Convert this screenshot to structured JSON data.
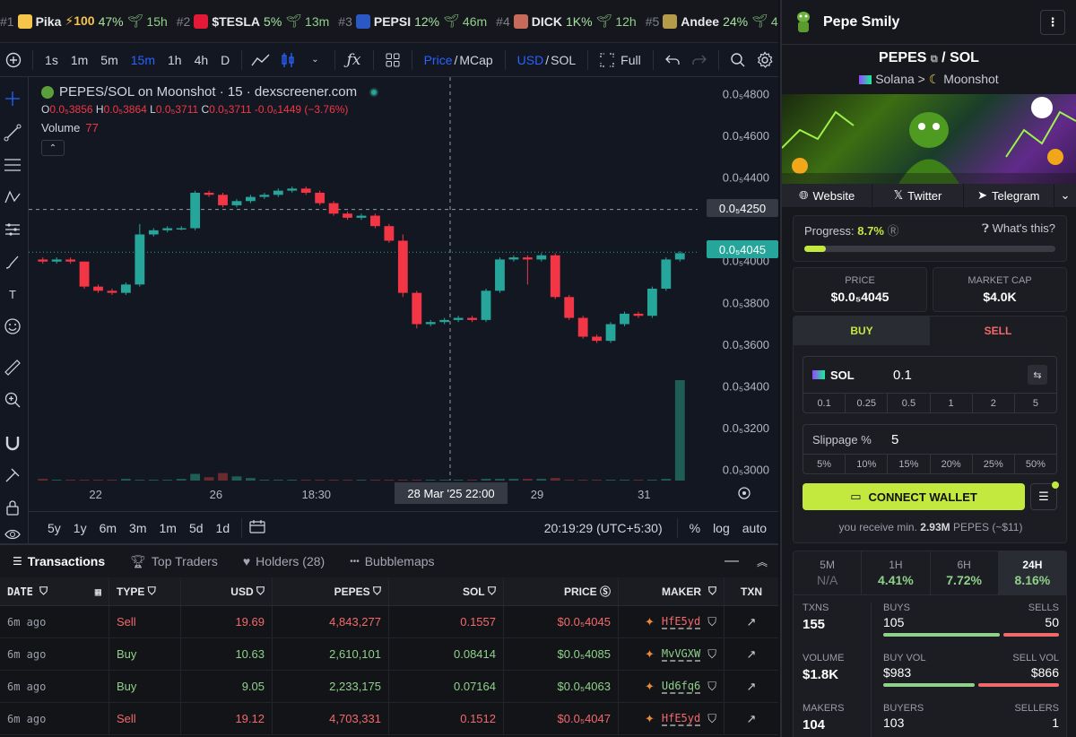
{
  "trending": [
    {
      "rank": "#1",
      "name": "Pika",
      "boost": "⚡100",
      "change": "47%",
      "age": "15h",
      "icon_color": "#f5c44b"
    },
    {
      "rank": "#2",
      "name": "$TESLA",
      "boost": "",
      "change": "5%",
      "age": "13m",
      "icon_color": "#e31937"
    },
    {
      "rank": "#3",
      "name": "PEPSI",
      "boost": "",
      "change": "12%",
      "age": "46m",
      "icon_color": "#2a59c6"
    },
    {
      "rank": "#4",
      "name": "DICK",
      "boost": "",
      "change": "1K%",
      "age": "12h",
      "icon_color": "#c66b5a"
    },
    {
      "rank": "#5",
      "name": "Andee",
      "boost": "",
      "change": "24%",
      "age": "4h",
      "icon_color": "#b59a4a"
    }
  ],
  "toolbar": {
    "intervals": [
      "1s",
      "1m",
      "5m",
      "15m",
      "1h",
      "4h",
      "D"
    ],
    "active_interval": "15m",
    "price": "Price",
    "mcap": "MCap",
    "usd": "USD",
    "sol": "SOL",
    "full": "Full"
  },
  "chart": {
    "title": "PEPES/SOL on Moonshot · 15 · dexscreener.com",
    "ohlc": {
      "o_label": "O",
      "o": "0.0₅3856",
      "h_label": "H",
      "h": "0.0₅3864",
      "l_label": "L",
      "l": "0.0₅3711",
      "c_label": "C",
      "c": "0.0₅3711",
      "chg": "-0.0₆1449 (−3.76%)"
    },
    "volume_label": "Volume",
    "volume_value": "77",
    "y_ticks": [
      "0.0₅4800",
      "0.0₅4600",
      "0.0₅4400",
      "0.0₅4000",
      "0.0₅3800",
      "0.0₅3600",
      "0.0₅3400",
      "0.0₅3200",
      "0.0₅3000"
    ],
    "crosshair_price": "0.0₅4250",
    "last_price": "0.0₅4045",
    "x_ticks": [
      "22",
      "26",
      "18:30",
      "29",
      "31"
    ],
    "crosshair_time": "28 Mar '25   22:00",
    "ranges": [
      "5y",
      "1y",
      "6m",
      "3m",
      "1m",
      "5d",
      "1d"
    ],
    "clock": "20:19:29 (UTC+5:30)",
    "percent": "%",
    "log": "log",
    "auto": "auto",
    "up_color": "#26a69a",
    "down_color": "#f23645"
  },
  "chart_data": {
    "type": "candlestick",
    "title": "PEPES/SOL on Moonshot · 15 · dexscreener.com",
    "xlabel": "",
    "ylabel": "",
    "ylim": [
      2.95e-06,
      4.85e-06
    ],
    "candles": [
      {
        "o": 4.01e-06,
        "c": 4e-06,
        "h": 4.02e-06,
        "l": 3.99e-06
      },
      {
        "o": 4e-06,
        "c": 4.01e-06,
        "h": 4.02e-06,
        "l": 3.99e-06
      },
      {
        "o": 4.01e-06,
        "c": 4e-06,
        "h": 4.02e-06,
        "l": 3.99e-06
      },
      {
        "o": 4e-06,
        "c": 3.88e-06,
        "h": 4e-06,
        "l": 3.87e-06
      },
      {
        "o": 3.88e-06,
        "c": 3.86e-06,
        "h": 3.89e-06,
        "l": 3.85e-06
      },
      {
        "o": 3.86e-06,
        "c": 3.85e-06,
        "h": 3.87e-06,
        "l": 3.84e-06
      },
      {
        "o": 3.85e-06,
        "c": 3.89e-06,
        "h": 3.9e-06,
        "l": 3.84e-06
      },
      {
        "o": 3.89e-06,
        "c": 4.13e-06,
        "h": 4.18e-06,
        "l": 3.88e-06
      },
      {
        "o": 4.13e-06,
        "c": 4.15e-06,
        "h": 4.16e-06,
        "l": 4.12e-06
      },
      {
        "o": 4.15e-06,
        "c": 4.16e-06,
        "h": 4.17e-06,
        "l": 4.14e-06
      },
      {
        "o": 4.16e-06,
        "c": 4.16e-06,
        "h": 4.17e-06,
        "l": 4.15e-06
      },
      {
        "o": 4.16e-06,
        "c": 4.33e-06,
        "h": 4.34e-06,
        "l": 4.15e-06
      },
      {
        "o": 4.33e-06,
        "c": 4.32e-06,
        "h": 4.34e-06,
        "l": 4.31e-06
      },
      {
        "o": 4.32e-06,
        "c": 4.27e-06,
        "h": 4.33e-06,
        "l": 4.26e-06
      },
      {
        "o": 4.27e-06,
        "c": 4.29e-06,
        "h": 4.3e-06,
        "l": 4.26e-06
      },
      {
        "o": 4.29e-06,
        "c": 4.31e-06,
        "h": 4.32e-06,
        "l": 4.28e-06
      },
      {
        "o": 4.31e-06,
        "c": 4.32e-06,
        "h": 4.33e-06,
        "l": 4.3e-06
      },
      {
        "o": 4.32e-06,
        "c": 4.34e-06,
        "h": 4.35e-06,
        "l": 4.31e-06
      },
      {
        "o": 4.34e-06,
        "c": 4.35e-06,
        "h": 4.36e-06,
        "l": 4.33e-06
      },
      {
        "o": 4.35e-06,
        "c": 4.33e-06,
        "h": 4.36e-06,
        "l": 4.32e-06
      },
      {
        "o": 4.33e-06,
        "c": 4.28e-06,
        "h": 4.34e-06,
        "l": 4.27e-06
      },
      {
        "o": 4.28e-06,
        "c": 4.23e-06,
        "h": 4.29e-06,
        "l": 4.22e-06
      },
      {
        "o": 4.23e-06,
        "c": 4.21e-06,
        "h": 4.24e-06,
        "l": 4.2e-06
      },
      {
        "o": 4.21e-06,
        "c": 4.22e-06,
        "h": 4.23e-06,
        "l": 4.2e-06
      },
      {
        "o": 4.22e-06,
        "c": 4.17e-06,
        "h": 4.23e-06,
        "l": 4.16e-06
      },
      {
        "o": 4.17e-06,
        "c": 4.1e-06,
        "h": 4.18e-06,
        "l": 4.09e-06
      },
      {
        "o": 4.1e-06,
        "c": 3.85e-06,
        "h": 4.13e-06,
        "l": 3.83e-06
      },
      {
        "o": 3.85e-06,
        "c": 3.7e-06,
        "h": 3.86e-06,
        "l": 3.68e-06
      },
      {
        "o": 3.7e-06,
        "c": 3.71e-06,
        "h": 3.72e-06,
        "l": 3.69e-06
      },
      {
        "o": 3.71e-06,
        "c": 3.72e-06,
        "h": 3.73e-06,
        "l": 3.7e-06
      },
      {
        "o": 3.72e-06,
        "c": 3.73e-06,
        "h": 3.74e-06,
        "l": 3.71e-06
      },
      {
        "o": 3.73e-06,
        "c": 3.72e-06,
        "h": 3.74e-06,
        "l": 3.71e-06
      },
      {
        "o": 3.72e-06,
        "c": 3.86e-06,
        "h": 3.87e-06,
        "l": 3.71e-06
      },
      {
        "o": 3.86e-06,
        "c": 4.01e-06,
        "h": 4.02e-06,
        "l": 3.85e-06
      },
      {
        "o": 4.01e-06,
        "c": 4.02e-06,
        "h": 4.03e-06,
        "l": 4e-06
      },
      {
        "o": 4.02e-06,
        "c": 4.01e-06,
        "h": 4.03e-06,
        "l": 3.89e-06
      },
      {
        "o": 4.01e-06,
        "c": 4.03e-06,
        "h": 4.04e-06,
        "l": 4e-06
      },
      {
        "o": 4.03e-06,
        "c": 3.83e-06,
        "h": 4.04e-06,
        "l": 3.82e-06
      },
      {
        "o": 3.83e-06,
        "c": 3.73e-06,
        "h": 3.84e-06,
        "l": 3.72e-06
      },
      {
        "o": 3.73e-06,
        "c": 3.64e-06,
        "h": 3.74e-06,
        "l": 3.63e-06
      },
      {
        "o": 3.64e-06,
        "c": 3.62e-06,
        "h": 3.65e-06,
        "l": 3.61e-06
      },
      {
        "o": 3.62e-06,
        "c": 3.7e-06,
        "h": 3.71e-06,
        "l": 3.61e-06
      },
      {
        "o": 3.7e-06,
        "c": 3.75e-06,
        "h": 3.76e-06,
        "l": 3.69e-06
      },
      {
        "o": 3.75e-06,
        "c": 3.74e-06,
        "h": 3.76e-06,
        "l": 3.73e-06
      },
      {
        "o": 3.74e-06,
        "c": 3.87e-06,
        "h": 3.88e-06,
        "l": 3.73e-06
      },
      {
        "o": 3.87e-06,
        "c": 4.01e-06,
        "h": 4.02e-06,
        "l": 3.86e-06
      },
      {
        "o": 4.01e-06,
        "c": 4.04e-06,
        "h": 4.05e-06,
        "l": 4e-06
      }
    ],
    "volume": [
      2,
      1,
      1,
      1,
      1,
      1,
      2,
      1,
      1,
      1,
      2,
      8,
      4,
      9,
      5,
      3,
      1,
      1,
      1,
      1,
      1,
      1,
      1,
      1,
      1,
      1,
      1,
      1,
      1,
      1,
      1,
      1,
      2,
      2,
      2,
      2,
      2,
      3,
      1,
      1,
      1,
      1,
      1,
      1,
      1,
      2,
      120
    ]
  },
  "bottom_tabs": [
    {
      "label": "Transactions"
    },
    {
      "label": "Top Traders"
    },
    {
      "label": "Holders (28)"
    },
    {
      "label": "Bubblemaps"
    }
  ],
  "table": {
    "headers": {
      "date": "DATE",
      "type": "TYPE",
      "usd": "USD",
      "pepes": "PEPES",
      "sol": "SOL",
      "price": "PRICE",
      "maker": "MAKER",
      "txn": "TXN"
    },
    "rows": [
      {
        "date": "6m ago",
        "type": "Sell",
        "usd": "19.69",
        "pepes": "4,843,277",
        "sol": "0.1557",
        "price": "$0.0₅4045",
        "maker": "HfE5yd"
      },
      {
        "date": "6m ago",
        "type": "Buy",
        "usd": "10.63",
        "pepes": "2,610,101",
        "sol": "0.08414",
        "price": "$0.0₅4085",
        "maker": "MvVGXW"
      },
      {
        "date": "6m ago",
        "type": "Buy",
        "usd": "9.05",
        "pepes": "2,233,175",
        "sol": "0.07164",
        "price": "$0.0₅4063",
        "maker": "Ud6fq6"
      },
      {
        "date": "6m ago",
        "type": "Sell",
        "usd": "19.12",
        "pepes": "4,703,331",
        "sol": "0.1512",
        "price": "$0.0₅4047",
        "maker": "HfE5yd"
      }
    ]
  },
  "right": {
    "token_name": "Pepe Smily",
    "pair_base": "PEPES",
    "pair_quote": "SOL",
    "chain": "Solana",
    "dex": "Moonshot",
    "links": [
      "Website",
      "Twitter",
      "Telegram"
    ],
    "progress_label": "Progress:",
    "progress_value": "8.7%",
    "progress_fraction": 0.087,
    "whats_this": "What's this?",
    "price_label": "PRICE",
    "price_value": "$0.0₅4045",
    "mcap_label": "MARKET CAP",
    "mcap_value": "$4.0K",
    "buy_label": "BUY",
    "sell_label": "SELL",
    "amount_token": "SOL",
    "amount_value": "0.1",
    "amount_presets": [
      "0.1",
      "0.25",
      "0.5",
      "1",
      "2",
      "5"
    ],
    "slippage_label": "Slippage %",
    "slippage_value": "5",
    "slippage_presets": [
      "5%",
      "10%",
      "15%",
      "20%",
      "25%",
      "50%"
    ],
    "connect_label": "CONNECT WALLET",
    "receive_prefix": "you receive min.",
    "receive_amount": "2.93M",
    "receive_suffix": "PEPES (~$11)",
    "periods": [
      {
        "label": "5M",
        "value": "N/A"
      },
      {
        "label": "1H",
        "value": "4.41%"
      },
      {
        "label": "6H",
        "value": "7.72%"
      },
      {
        "label": "24H",
        "value": "8.16%"
      }
    ],
    "txns_label": "TXNS",
    "txns_value": "155",
    "buys_label": "BUYS",
    "buys_value": "105",
    "sells_label": "SELLS",
    "sells_value": "50",
    "volume_label": "VOLUME",
    "volume_value": "$1.8K",
    "buyvol_label": "BUY VOL",
    "buyvol_value": "$983",
    "sellvol_label": "SELL VOL",
    "sellvol_value": "$866",
    "makers_label": "MAKERS",
    "makers_value": "104",
    "buyers_label": "BUYERS",
    "buyers_value": "103",
    "sellers_label": "SELLERS",
    "sellers_value": "1",
    "accent": "#c4e93e"
  }
}
